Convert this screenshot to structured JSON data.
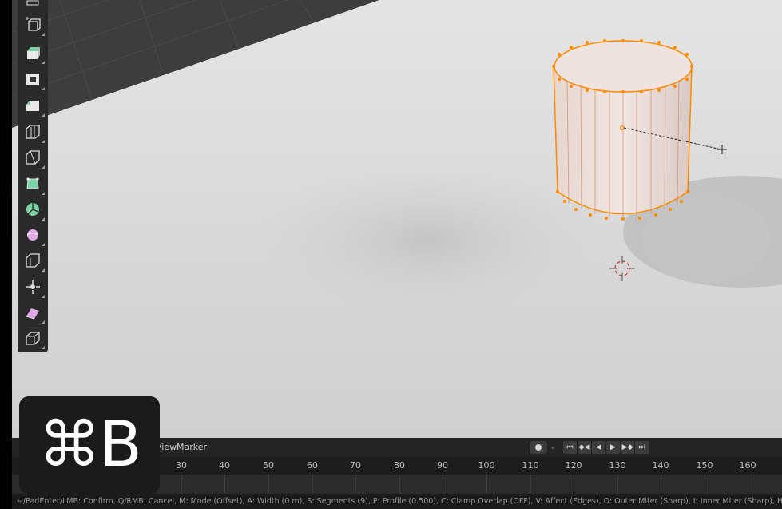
{
  "app": "Blender",
  "viewport": {
    "cursor_icon": "crosshair-icon",
    "origin_icon": "3d-cursor-icon"
  },
  "toolbar": {
    "tools": [
      {
        "name": "tool-measure",
        "icon": "ruler-icon"
      },
      {
        "name": "tool-add-cube",
        "icon": "add-cube-icon"
      },
      {
        "name": "tool-extrude-region",
        "icon": "extrude-region-icon"
      },
      {
        "name": "tool-inset-faces",
        "icon": "inset-faces-icon"
      },
      {
        "name": "tool-bevel",
        "icon": "bevel-icon"
      },
      {
        "name": "tool-loop-cut",
        "icon": "loop-cut-icon"
      },
      {
        "name": "tool-knife",
        "icon": "knife-icon"
      },
      {
        "name": "tool-poly-build",
        "icon": "poly-build-icon"
      },
      {
        "name": "tool-spin",
        "icon": "spin-icon"
      },
      {
        "name": "tool-smooth",
        "icon": "smooth-icon"
      },
      {
        "name": "tool-edge-slide",
        "icon": "edge-slide-icon"
      },
      {
        "name": "tool-shrink-fatten",
        "icon": "shrink-fatten-icon"
      },
      {
        "name": "tool-shear",
        "icon": "shear-icon"
      },
      {
        "name": "tool-rip-region",
        "icon": "rip-region-icon"
      }
    ]
  },
  "timeline": {
    "menu_view": "View",
    "menu_marker": "Marker",
    "playback_icons": [
      "jump-start-icon",
      "prev-keyframe-icon",
      "play-reverse-icon",
      "play-icon",
      "next-keyframe-icon",
      "jump-end-icon"
    ],
    "ticks": [
      "30",
      "40",
      "50",
      "60",
      "70",
      "80",
      "90",
      "100",
      "110",
      "120",
      "130",
      "140",
      "150",
      "160"
    ]
  },
  "statusbar": {
    "text": "↩/PadEnter/LMB: Confirm, Q/RMB: Cancel, M: Mode (Offset), A: Width (0 m), S: Segments (9), P: Profile (0.500), C: Clamp Overlap (OFF), V: Affect (Edges), O: Outer Miter (Sharp), I: Inner Miter (Sharp), H: Harden Normals (OFF)"
  },
  "shortcut_overlay": {
    "keys": "⌘B"
  },
  "colors": {
    "accent": "#ff8a00",
    "viewport_bg": "#d2d2d2",
    "ui_dark": "#2a2a2a"
  }
}
